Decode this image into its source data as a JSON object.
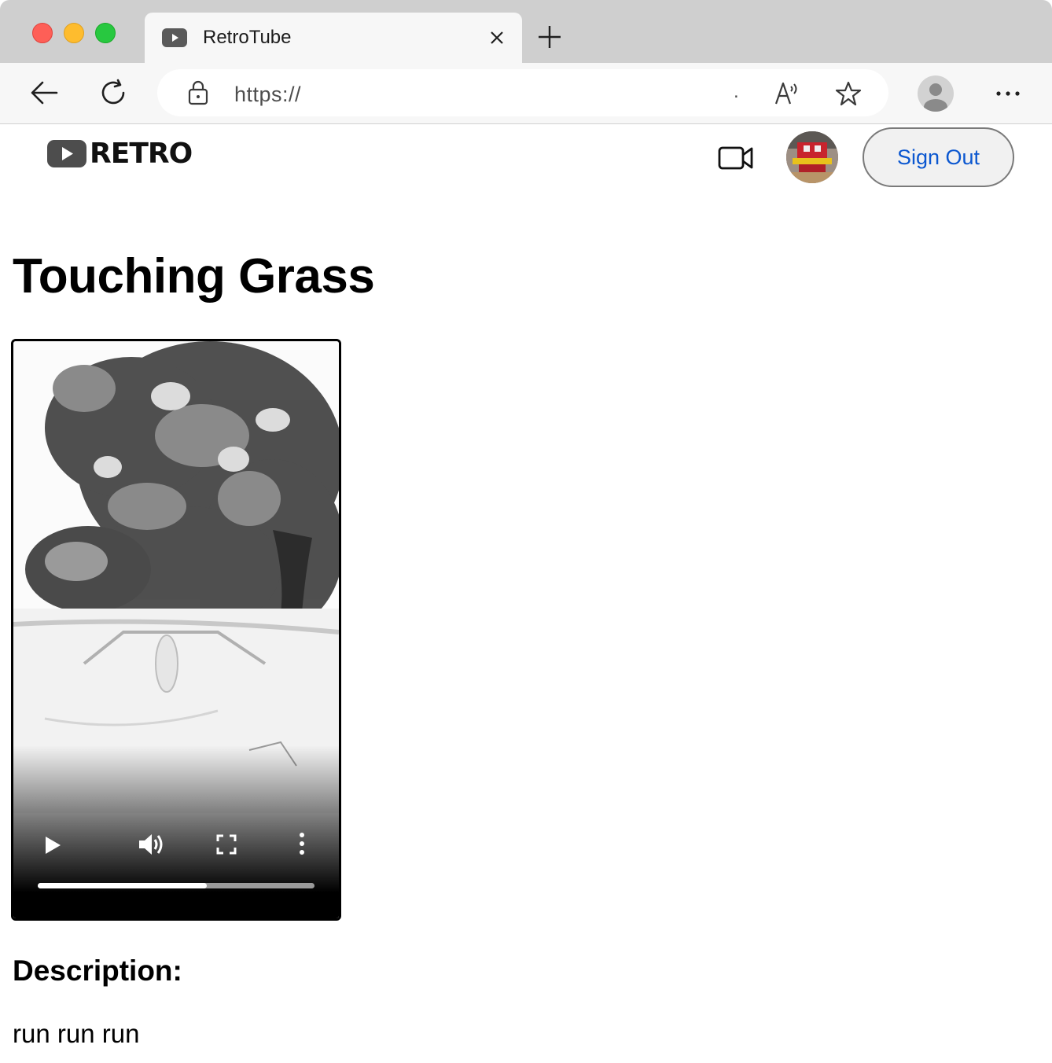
{
  "browser": {
    "tab_title": "RetroTube",
    "url": "https://",
    "url_tail": "."
  },
  "site": {
    "logo_text": "RETRO",
    "sign_out_label": "Sign Out",
    "accent_color": "#0b57d0"
  },
  "video": {
    "title": "Touching Grass",
    "progress": 0.61,
    "controls": [
      "play-icon",
      "volume-icon",
      "fullscreen-icon",
      "more-options-icon"
    ]
  },
  "description": {
    "heading": "Description:",
    "text": "run run run"
  }
}
